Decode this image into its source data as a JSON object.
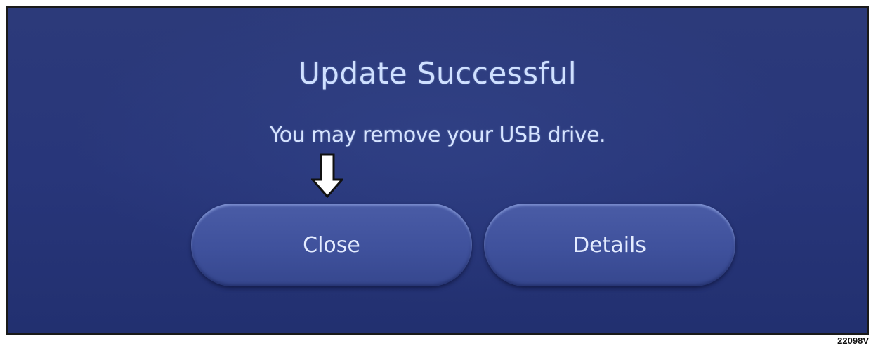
{
  "dialog": {
    "title": "Update Successful",
    "message": "You may remove your USB drive.",
    "buttons": {
      "close_label": "Close",
      "details_label": "Details"
    }
  },
  "annotation": {
    "pointer_icon": "down-arrow-icon",
    "figure_code": "22098V"
  },
  "colors": {
    "screen_background": "#28367a",
    "button_fill": "#3f519c",
    "text": "#d6e4ff"
  }
}
